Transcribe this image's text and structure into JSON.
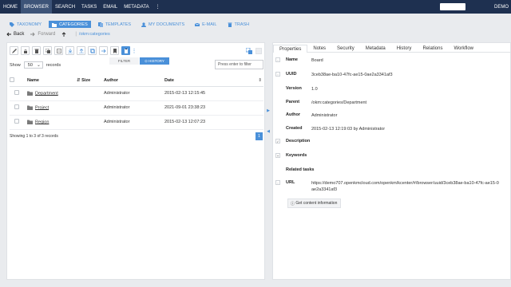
{
  "topbar": {
    "menu": [
      "HOME",
      "BROWSER",
      "SEARCH",
      "TASKS",
      "EMAIL",
      "METADATA",
      "⋮"
    ],
    "active_index": 1,
    "user": "DEMO"
  },
  "navtabs": [
    {
      "label": "TAXONOMY",
      "icon": "tag-icon"
    },
    {
      "label": "CATEGORIES",
      "icon": "folder-icon",
      "active": true
    },
    {
      "label": "TEMPLATES",
      "icon": "template-icon"
    },
    {
      "label": "MY DOCUMENTS",
      "icon": "user-icon"
    },
    {
      "label": "E-MAIL",
      "icon": "mail-icon"
    },
    {
      "label": "TRASH",
      "icon": "trash-icon"
    }
  ],
  "navrow": {
    "back": "Back",
    "forward": "Forward",
    "path": "/okm:categories"
  },
  "left": {
    "filter_tab": "FILTER",
    "history_tab": "HISTORY",
    "show_label": "Show",
    "show_value": "50",
    "records_label": "records",
    "filter_placeholder": "Press enter to filter",
    "columns": {
      "name": "Name",
      "size": "Size",
      "author": "Author",
      "date": "Date"
    },
    "rows": [
      {
        "name": "Department",
        "size": "",
        "author": "Administrator",
        "date": "2015-02-13 12:15:45"
      },
      {
        "name": "Project",
        "size": "",
        "author": "Administrator",
        "date": "2021-09-01 23:38:23"
      },
      {
        "name": "Region",
        "size": "",
        "author": "Administrator",
        "date": "2015-02-13 12:07:23"
      }
    ],
    "info": "Showing 1 to 3 of 3 records",
    "page": "1"
  },
  "right": {
    "tabs": [
      "Properties",
      "Notes",
      "Security",
      "Metadata",
      "History",
      "Relations",
      "Workflow"
    ],
    "active_tab": 0,
    "props": {
      "name_k": "Name",
      "name_v": "Board",
      "uuid_k": "UUID",
      "uuid_v": "3ceb38ae-ba10-47fc-ae15-0ae2a3341af3",
      "version_k": "Version",
      "version_v": "1.0",
      "parent_k": "Parent",
      "parent_v": "/okm:categories/Department",
      "author_k": "Author",
      "author_v": "Administrator",
      "created_k": "Created",
      "created_v": "2015-02-13 12:19:03 by Administrator",
      "desc_k": "Description",
      "keywords_k": "Keywords",
      "related_k": "Related tasks",
      "url_k": "URL",
      "url_v": "https://demo707.openkmcloud.com/openkm/kcenter/#/browser/uuid/3ceb38ae-ba10-47fc-ae15-0ae2a3341af3"
    },
    "get_content": "Get content information"
  },
  "colors": {
    "navy": "#1e3050",
    "accent": "#4a90d9"
  }
}
